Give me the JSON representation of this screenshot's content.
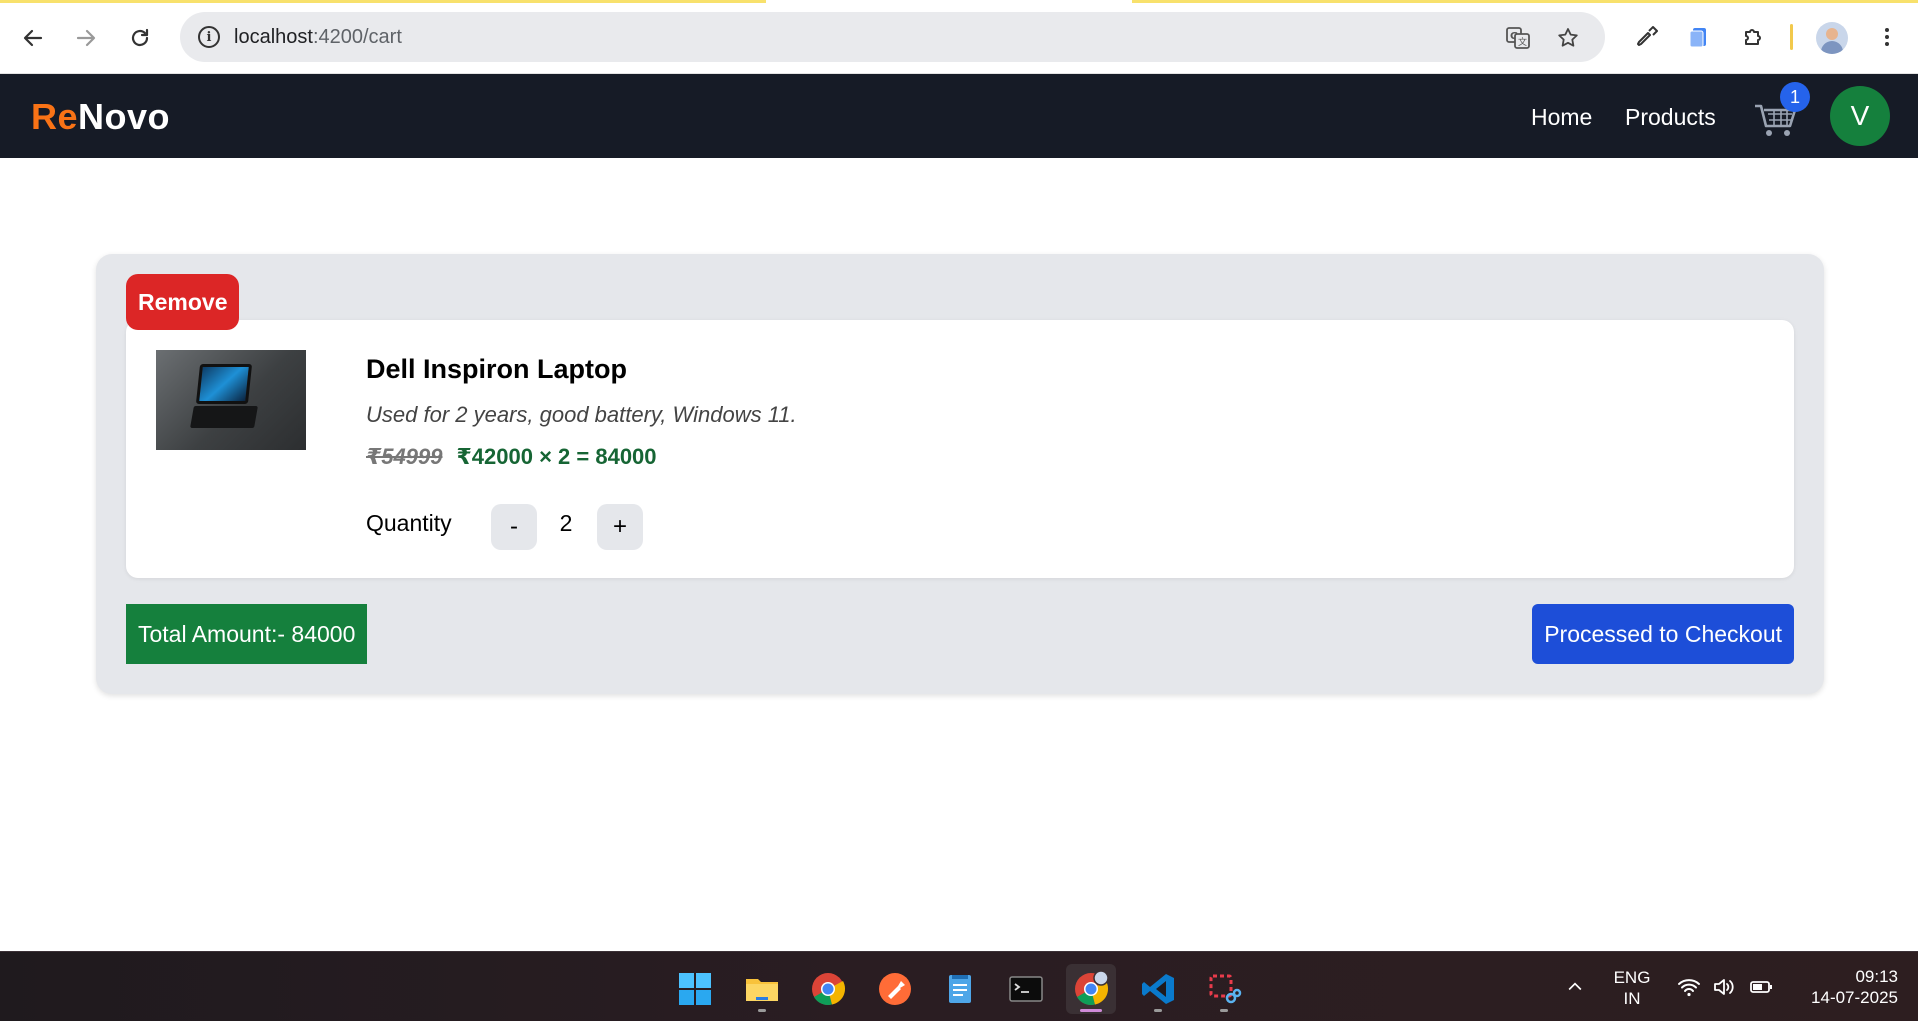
{
  "browser": {
    "url_host": "localhost",
    "url_path": ":4200/cart"
  },
  "app": {
    "brand_part1": "Re",
    "brand_part2": "Novo",
    "nav": {
      "home": "Home",
      "products": "Products"
    },
    "cart_count": "1",
    "avatar_letter": "V"
  },
  "cart": {
    "remove_label": "Remove",
    "item": {
      "title": "Dell Inspiron Laptop",
      "description": "Used for 2 years, good battery, Windows 11.",
      "original_price": "₹54999",
      "price_line": "₹42000 × 2 = 84000",
      "quantity_label": "Quantity",
      "decrement_label": "-",
      "quantity": "2",
      "increment_label": "+"
    },
    "total_label": "Total Amount:- 84000",
    "checkout_label": "Processed to Checkout"
  },
  "taskbar": {
    "language_line1": "ENG",
    "language_line2": "IN",
    "time": "09:13",
    "date": "14-07-2025",
    "apps": [
      "start-icon",
      "file-explorer-icon",
      "chrome-icon",
      "postman-icon",
      "notepad-icon",
      "terminal-icon",
      "chrome-profile-icon",
      "vscode-icon",
      "snipping-tool-icon"
    ]
  },
  "colors": {
    "brand_accent": "#f97316",
    "navbar_bg": "#161b26",
    "remove": "#dc2626",
    "total_bg": "#15803d",
    "checkout_bg": "#1d4ed8",
    "price_green": "#166534",
    "badge": "#2563eb"
  }
}
